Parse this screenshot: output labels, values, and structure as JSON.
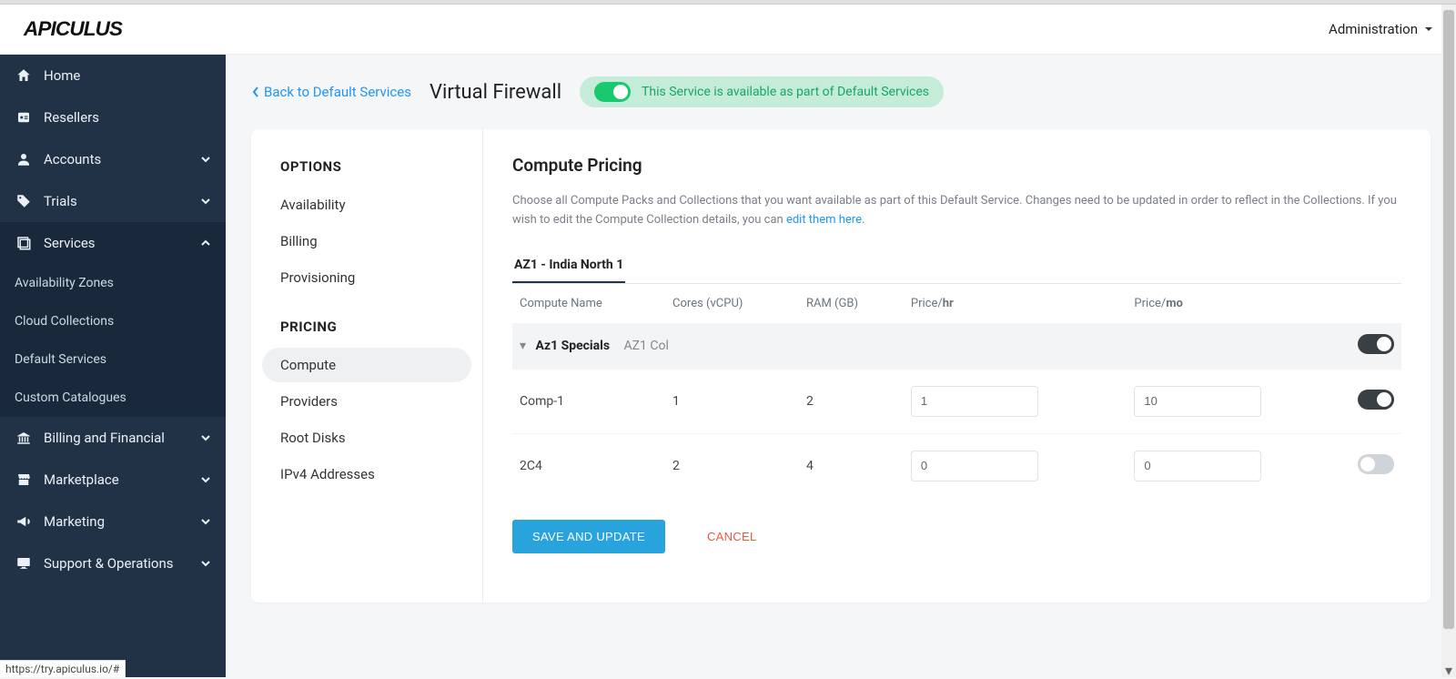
{
  "brand": "APICULUS",
  "admin": {
    "label": "Administration"
  },
  "sidebar": {
    "items": [
      {
        "label": "Home",
        "icon": "home"
      },
      {
        "label": "Resellers",
        "icon": "badge"
      },
      {
        "label": "Accounts",
        "icon": "person",
        "expandable": true
      },
      {
        "label": "Trials",
        "icon": "tag",
        "expandable": true
      },
      {
        "label": "Services",
        "icon": "layers",
        "expandable": true,
        "expanded": true,
        "children": [
          {
            "label": "Availability Zones"
          },
          {
            "label": "Cloud Collections"
          },
          {
            "label": "Default Services"
          },
          {
            "label": "Custom Catalogues"
          }
        ]
      },
      {
        "label": "Billing and Financial",
        "icon": "bank",
        "expandable": true
      },
      {
        "label": "Marketplace",
        "icon": "store",
        "expandable": true
      },
      {
        "label": "Marketing",
        "icon": "megaphone",
        "expandable": true
      },
      {
        "label": "Support & Operations",
        "icon": "monitor",
        "expandable": true
      }
    ]
  },
  "header": {
    "back_label": "Back to Default Services",
    "title": "Virtual Firewall",
    "status_text": "This Service is available as part of Default Services",
    "status_on": true
  },
  "options": {
    "heading": "OPTIONS",
    "items": [
      {
        "label": "Availability"
      },
      {
        "label": "Billing"
      },
      {
        "label": "Provisioning"
      }
    ]
  },
  "pricing_nav": {
    "heading": "PRICING",
    "items": [
      {
        "label": "Compute",
        "active": true
      },
      {
        "label": "Providers"
      },
      {
        "label": "Root Disks"
      },
      {
        "label": "IPv4 Addresses"
      }
    ]
  },
  "panel": {
    "title": "Compute Pricing",
    "desc_a": "Choose all Compute Packs and Collections that you want available as part of this Default Service. Changes need to be updated in order to reflect in the Collections. If you wish to edit the Compute Collection details, you can ",
    "desc_link": "edit them here",
    "desc_b": ".",
    "tab": "AZ1 - India North 1",
    "columns": {
      "name": "Compute Name",
      "cores": "Cores (vCPU)",
      "ram": "RAM (GB)",
      "price_hr_prefix": "Price/",
      "price_hr_bold": "hr",
      "price_mo_prefix": "Price/",
      "price_mo_bold": "mo"
    },
    "group": {
      "name": "Az1 Specials",
      "sub": "AZ1 Col",
      "enabled": true
    },
    "rows": [
      {
        "name": "Comp-1",
        "cores": "1",
        "ram": "2",
        "price_hr": "1",
        "price_mo": "10",
        "enabled": true
      },
      {
        "name": "2C4",
        "cores": "2",
        "ram": "4",
        "price_hr": "0",
        "price_mo": "0",
        "enabled": false
      }
    ],
    "save_label": "SAVE AND UPDATE",
    "cancel_label": "CANCEL"
  },
  "status_url": "https://try.apiculus.io/#"
}
